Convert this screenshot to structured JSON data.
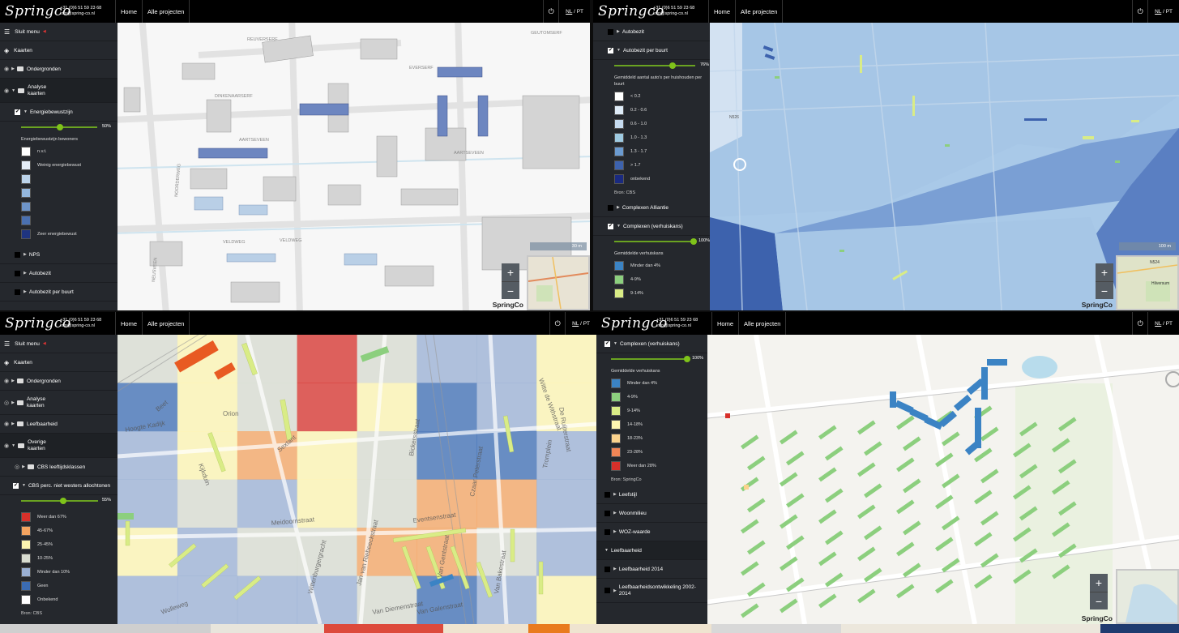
{
  "brand": {
    "logo": "Springco",
    "phone": "+31 (0)6 51 59 23 68",
    "email": "info@spring-co.nl",
    "watermark": "SpringCo"
  },
  "nav": {
    "home": "Home",
    "projects": "Alle projecten",
    "lang_nl": "NL",
    "lang_sep": "/",
    "lang_pt": "PT"
  },
  "panel1": {
    "menu_close": "Sluit menu",
    "kaarten": "Kaarten",
    "ondergronden": "Ondergronden",
    "analyse": "Analyse kaarten",
    "layer": "Energiebewustzijn",
    "opacity": "50%",
    "opacity_level": 50,
    "legend_title": "Energiebewustzijn bewoners",
    "legend": [
      {
        "label": "n.v.t.",
        "color": "#ffffff"
      },
      {
        "label": "Weinig energiebewust",
        "color": "#e6eef6"
      },
      {
        "label": "",
        "color": "#bcd3ea"
      },
      {
        "label": "",
        "color": "#93b6dc"
      },
      {
        "label": "",
        "color": "#6e95c9"
      },
      {
        "label": "",
        "color": "#4a70b0"
      },
      {
        "label": "Zeer energiebewust",
        "color": "#1f3480"
      }
    ],
    "more": [
      "NPS",
      "Autobezit",
      "Autobezit per buurt"
    ],
    "scale": "30 m",
    "streets": [
      "REUVERSERF",
      "GEUTOMSERF",
      "EVERSERF",
      "DINKENAARSERF",
      "AARTSEVEEN",
      "AARTSEVEEN",
      "VELDWEG",
      "VELDWEG",
      "NOORDERWEG",
      "NEUSVEEN"
    ]
  },
  "panel2": {
    "items": [
      "Autobezit",
      "Autobezit per buurt"
    ],
    "opacity": "76%",
    "opacity_level": 76,
    "legend_title": "Gemiddeld aantal auto's per huishouden per buurt",
    "legend": [
      {
        "label": "< 0.2",
        "color": "#ffffff"
      },
      {
        "label": "0.2 - 0.6",
        "color": "#deebf7"
      },
      {
        "label": "0.6 - 1.0",
        "color": "#c6dbef"
      },
      {
        "label": "1.0 - 1.3",
        "color": "#9ecae1"
      },
      {
        "label": "1.3 - 1.7",
        "color": "#6b9bd0"
      },
      {
        "label": "> 1.7",
        "color": "#3d62ad"
      },
      {
        "label": "onbekend",
        "color": "#1a2a80"
      }
    ],
    "bron": "Bron: CBS",
    "complexen_alliantie": "Complexen Alliantie",
    "complexen": "Complexen (verhuiskans)",
    "opacity2": "100%",
    "opacity2_level": 100,
    "legend2_title": "Gemiddelde verhuiskans",
    "legend2": [
      {
        "label": "Minder dan 4%",
        "color": "#3b83c4"
      },
      {
        "label": "4-9%",
        "color": "#8ccf7e"
      },
      {
        "label": "9-14%",
        "color": "#d9ec86"
      }
    ],
    "scale": "100 m",
    "road": "N526",
    "minimap_road": "N524",
    "minimap_place": "Hilversum"
  },
  "panel3": {
    "menu_close": "Sluit menu",
    "kaarten": "Kaarten",
    "ondergronden": "Ondergronden",
    "analyse": "Analyse kaarten",
    "leefbaarheid": "Leefbaarheid",
    "overige": "Overige kaarten",
    "cbs1": "CBS leeftijdsklassen",
    "cbs2": "CBS perc. niet westers allochtonen",
    "opacity": "55%",
    "opacity_level": 55,
    "legend": [
      {
        "label": "Meer dan 67%",
        "color": "#d7302a"
      },
      {
        "label": "45-67%",
        "color": "#f4a460"
      },
      {
        "label": "25-45%",
        "color": "#fdf5b0"
      },
      {
        "label": "10-25%",
        "color": "#d8dcd0"
      },
      {
        "label": "Minder dan 10%",
        "color": "#9ab0d4"
      },
      {
        "label": "Geen",
        "color": "#3b6cb3"
      },
      {
        "label": "Onbekend",
        "color": "#ffffff"
      }
    ],
    "bron": "Bron: CBS",
    "streets": [
      "Beet",
      "Orion",
      "Sextant",
      "Kijkduin",
      "Bickersstraat",
      "Czaar Peterstraat",
      "Witte de Withstraat",
      "De Ruijterstraat",
      "Jan van Riebeeckstraat",
      "Eventsenstraat",
      "Van Gentstraat",
      "Van Galenstraat",
      "Van Diemenstraat",
      "Hoogte Kadijk",
      "Meidoornstraat",
      "Wittenburgergracht",
      "Wolleweg",
      "Tromplein",
      "Van Bakestraat"
    ]
  },
  "panel4": {
    "layer": "Complexen (verhuiskans)",
    "opacity": "100%",
    "opacity_level": 100,
    "legend_title": "Gemiddelde verhuiskans",
    "legend": [
      {
        "label": "Minder dan 4%",
        "color": "#3b83c4"
      },
      {
        "label": "4-9%",
        "color": "#8ccf7e"
      },
      {
        "label": "9-14%",
        "color": "#d9ec86"
      },
      {
        "label": "14-18%",
        "color": "#fdf5b0"
      },
      {
        "label": "18-23%",
        "color": "#fbd38d"
      },
      {
        "label": "23-28%",
        "color": "#f18656"
      },
      {
        "label": "Meer dan 28%",
        "color": "#d7302a"
      }
    ],
    "bron": "Bron: SpringCo",
    "more": [
      "Leefstijl",
      "Woonmilieu",
      "WOZ-waarde"
    ],
    "group": "Leefbaarheid",
    "sub": [
      "Leefbaarheid 2014",
      "Leefbaarheidsontwikkeling 2002-2014"
    ]
  },
  "colors": {
    "green": "#7fc31a",
    "bar": "#000000",
    "sidebar": "#25282d"
  },
  "footer_colors": [
    "#cfcfcf",
    "#e8e5dc",
    "#dd4a3c",
    "#efe4d0",
    "#e97b1e",
    "#efe4d0",
    "#d8d8d8",
    "#ece7dc",
    "#1f3b6f"
  ]
}
